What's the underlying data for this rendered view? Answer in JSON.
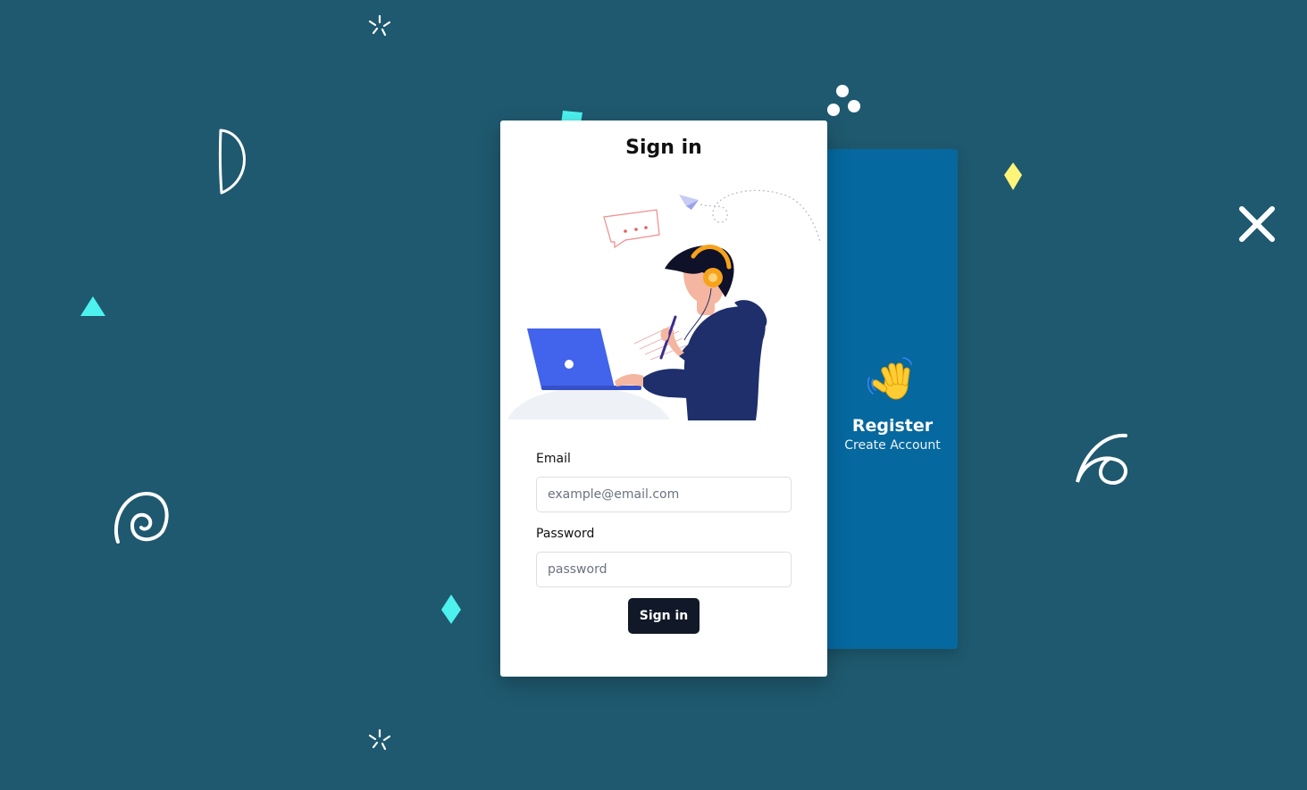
{
  "signin": {
    "title": "Sign in",
    "email_label": "Email",
    "email_placeholder": "example@email.com",
    "email_value": "",
    "password_label": "Password",
    "password_placeholder": "password",
    "password_value": "",
    "submit_label": "Sign in"
  },
  "register": {
    "icon": "waving-hand-icon",
    "title": "Register",
    "subtitle": "Create Account"
  },
  "colors": {
    "background": "#1f596f",
    "register_panel": "#05689f",
    "signin_button": "#111827",
    "accent_cyan": "#4df2ee",
    "accent_yellow": "#fff47a"
  }
}
